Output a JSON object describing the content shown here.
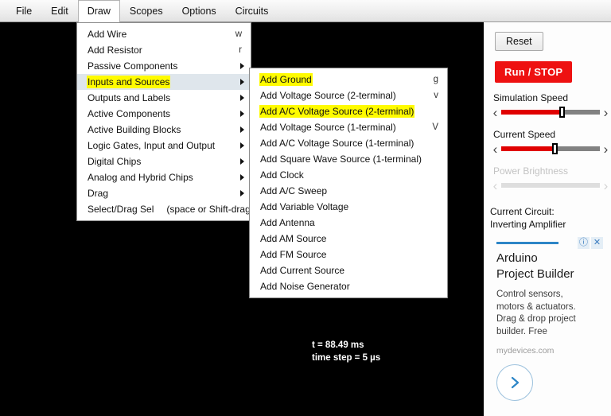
{
  "menubar": {
    "items": [
      {
        "label": "File",
        "active": false
      },
      {
        "label": "Edit",
        "active": false
      },
      {
        "label": "Draw",
        "active": true
      },
      {
        "label": "Scopes",
        "active": false
      },
      {
        "label": "Options",
        "active": false
      },
      {
        "label": "Circuits",
        "active": false
      }
    ]
  },
  "canvas": {
    "time_label": "t = 88.49 ms",
    "timestep_label": "time step = 5 µs",
    "background_color": "#000000"
  },
  "draw_menu": {
    "rows": [
      {
        "label": "Add Wire",
        "shortcut": "w",
        "submenu": false,
        "hovered": false,
        "marked": false
      },
      {
        "label": "Add Resistor",
        "shortcut": "r",
        "submenu": false,
        "hovered": false,
        "marked": false
      },
      {
        "label": "Passive Components",
        "shortcut": "",
        "submenu": true,
        "hovered": false,
        "marked": false
      },
      {
        "label": "Inputs and Sources",
        "shortcut": "",
        "submenu": true,
        "hovered": true,
        "marked": true
      },
      {
        "label": "Outputs and Labels",
        "shortcut": "",
        "submenu": true,
        "hovered": false,
        "marked": false
      },
      {
        "label": "Active Components",
        "shortcut": "",
        "submenu": true,
        "hovered": false,
        "marked": false
      },
      {
        "label": "Active Building Blocks",
        "shortcut": "",
        "submenu": true,
        "hovered": false,
        "marked": false
      },
      {
        "label": "Logic Gates, Input and Output",
        "shortcut": "",
        "submenu": true,
        "hovered": false,
        "marked": false
      },
      {
        "label": "Digital Chips",
        "shortcut": "",
        "submenu": true,
        "hovered": false,
        "marked": false
      },
      {
        "label": "Analog and Hybrid Chips",
        "shortcut": "",
        "submenu": true,
        "hovered": false,
        "marked": false
      },
      {
        "label": "Drag",
        "shortcut": "",
        "submenu": true,
        "hovered": false,
        "marked": false
      },
      {
        "label": "Select/Drag Sel",
        "paren": "(space or Shift-drag)",
        "shortcut": "",
        "submenu": false,
        "hovered": false,
        "marked": false
      }
    ]
  },
  "sources_submenu": {
    "rows": [
      {
        "label": "Add Ground",
        "shortcut": "g",
        "marked": true
      },
      {
        "label": "Add Voltage Source (2-terminal)",
        "shortcut": "v",
        "marked": false
      },
      {
        "label": "Add A/C Voltage Source (2-terminal)",
        "shortcut": "",
        "marked": true
      },
      {
        "label": "Add Voltage Source (1-terminal)",
        "shortcut": "V",
        "marked": false
      },
      {
        "label": "Add A/C Voltage Source (1-terminal)",
        "shortcut": "",
        "marked": false
      },
      {
        "label": "Add Square Wave Source (1-terminal)",
        "shortcut": "",
        "marked": false
      },
      {
        "label": "Add Clock",
        "shortcut": "",
        "marked": false
      },
      {
        "label": "Add A/C Sweep",
        "shortcut": "",
        "marked": false
      },
      {
        "label": "Add Variable Voltage",
        "shortcut": "",
        "marked": false
      },
      {
        "label": "Add Antenna",
        "shortcut": "",
        "marked": false
      },
      {
        "label": "Add AM Source",
        "shortcut": "",
        "marked": false
      },
      {
        "label": "Add FM Source",
        "shortcut": "",
        "marked": false
      },
      {
        "label": "Add Current Source",
        "shortcut": "",
        "marked": false
      },
      {
        "label": "Add Noise Generator",
        "shortcut": "",
        "marked": false
      }
    ]
  },
  "panel": {
    "reset_label": "Reset",
    "run_stop_label": "Run / STOP",
    "run_stop_color": "#ee1111",
    "sliders": [
      {
        "label": "Simulation Speed",
        "value_percent": 62,
        "disabled": false
      },
      {
        "label": "Current Speed",
        "value_percent": 55,
        "disabled": false
      },
      {
        "label": "Power Brightness",
        "value_percent": 0,
        "disabled": true
      }
    ],
    "left_arrow": "‹",
    "right_arrow": "›",
    "circuit_label": "Current Circuit:",
    "circuit_name": "Inverting Amplifier"
  },
  "ad": {
    "info_icon": "ⓘ",
    "close_icon": "✕",
    "title_line1": "Arduino",
    "title_line2": "Project Builder",
    "body_line1": "Control sensors,",
    "body_line2": "motors & actuators.",
    "body_line3": "Drag & drop project",
    "body_line4": "builder. Free",
    "domain": "mydevices.com",
    "accent_color": "#2d86c7"
  }
}
